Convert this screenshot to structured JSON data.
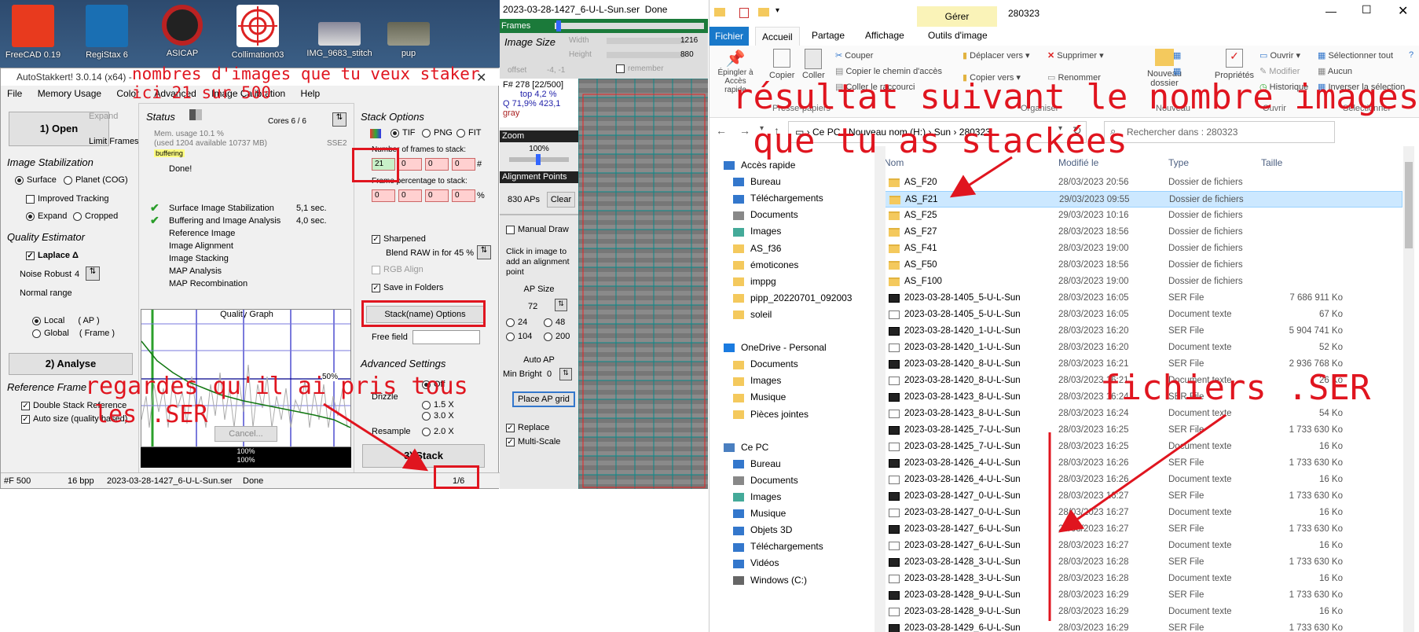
{
  "desktop": {
    "icons": [
      {
        "label": "FreeCAD 0.19"
      },
      {
        "label": "RegiStax 6"
      },
      {
        "label": "ASICAP"
      },
      {
        "label": "Collimation03"
      },
      {
        "label": "IMG_9683_stitch"
      },
      {
        "label": "pup"
      }
    ]
  },
  "autostakkert": {
    "title": "AutoStakkert! 3.0.14 (x64) - ",
    "menu": [
      "File",
      "Memory Usage",
      "Color",
      "Advanced",
      "Image Calibration",
      "Help"
    ],
    "open_button": "1) Open",
    "expand_label": "Expand",
    "limit_frames": "Limit Frames",
    "image_stabilization": "Image Stabilization",
    "surface": "Surface",
    "planet": "Planet (COG)",
    "improved_tracking": "Improved Tracking",
    "expand": "Expand",
    "cropped": "Cropped",
    "quality_estimator": "Quality Estimator",
    "laplace": "Laplace Δ",
    "noise_robust": "Noise Robust",
    "noise_value": "4",
    "normal_range": "Normal range",
    "local": "Local",
    "local_ap": "( AP )",
    "global": "Global",
    "global_frame": "( Frame )",
    "analyse_button": "2) Analyse",
    "reference_frame": "Reference Frame",
    "double_stack": "Double Stack Reference",
    "auto_size": "Auto size (quality based)",
    "status": "Status",
    "cores": "Cores 6 / 6",
    "mem_usage": "Mem. usage 10.1 %",
    "mem_used": "(used 1204 available 10737 MB)",
    "sse": "SSE2",
    "buffering": "buffering",
    "done": "Done!",
    "steps": [
      {
        "name": "Surface Image Stabilization",
        "time": "5,1 sec.",
        "done": true
      },
      {
        "name": "Buffering and Image Analysis",
        "time": "4,0 sec.",
        "done": true
      },
      {
        "name": "Reference Image",
        "time": "",
        "done": false
      },
      {
        "name": "Image Alignment",
        "time": "",
        "done": false
      },
      {
        "name": "Image Stacking",
        "time": "",
        "done": false
      },
      {
        "name": "MAP Analysis",
        "time": "",
        "done": false
      },
      {
        "name": "MAP Recombination",
        "time": "",
        "done": false
      }
    ],
    "quality_graph": "Quality Graph",
    "pct50": "50%",
    "cancel": "Cancel...",
    "pct100a": "100%",
    "pct100b": "100%",
    "stack_options": "Stack Options",
    "tif": "TIF",
    "png": "PNG",
    "fit": "FIT",
    "frames_to_stack": "Number of frames to stack:",
    "frames_values": [
      "21",
      "0",
      "0",
      "0"
    ],
    "hash": "#",
    "frame_pct": "Frame percentage to stack:",
    "pct_values": [
      "0",
      "0",
      "0",
      "0"
    ],
    "pct_sign": "%",
    "sharpened": "Sharpened",
    "blend_raw": "Blend RAW in for 45 %",
    "rgb_align": "RGB Align",
    "save_folders": "Save in Folders",
    "stack_name_options": "Stack(name) Options",
    "free_field": "Free field",
    "advanced_settings": "Advanced Settings",
    "drizzle": "Drizzle",
    "off": "Off",
    "d15": "1.5 X",
    "d30": "3.0 X",
    "resample": "Resample",
    "r20": "2.0 X",
    "stack_button": "3) Stack",
    "statusbar": {
      "frames": "#F 500",
      "bpp": "16 bpp",
      "file": "2023-03-28-1427_6-U-L-Sun.ser",
      "state": "Done",
      "progress": "1/6"
    }
  },
  "ser_viewer": {
    "title": "2023-03-28-1427_6-U-L-Sun.ser",
    "title_state": "Done",
    "frames": "Frames",
    "image_size": "Image Size",
    "width": "Width",
    "height": "Height",
    "width_val": "1216",
    "height_val": "880",
    "offset": "offset",
    "offset_val": "-4, -1",
    "remember": "remember",
    "frame_info": "F# 278 [22/500]",
    "top_pct": "top 4,2 %",
    "q_info": "Q 71,9%   423,1",
    "gray": "gray",
    "zoom": "Zoom",
    "zoom_val": "100%",
    "alignment_points": "Alignment Points",
    "aps": "830 APs",
    "clear": "Clear",
    "manual_draw": "Manual Draw",
    "click_help": "Click in image to add an alignment point",
    "ap_size": "AP Size",
    "ap_sizes": [
      "72",
      "24",
      "48",
      "104",
      "200"
    ],
    "auto_ap": "Auto AP",
    "min_bright": "Min Bright",
    "min_bright_val": "0",
    "place_grid": "Place AP grid",
    "replace": "Replace",
    "multiscale": "Multi-Scale"
  },
  "explorer": {
    "manage": "Gérer",
    "window_title": "280323",
    "tabs": [
      "Fichier",
      "Accueil",
      "Partage",
      "Affichage",
      "Outils d'image"
    ],
    "ribbon": {
      "pin": "Épingler à Accès rapide",
      "copy": "Copier",
      "paste": "Coller",
      "cut": "Couper",
      "copy_path": "Copier le chemin d'accès",
      "paste_shortcut": "Coller le raccourci",
      "clipboard": "Presse-papiers",
      "move_to": "Déplacer vers",
      "copy_to": "Copier vers",
      "delete": "Supprimer",
      "rename": "Renommer",
      "organize": "Organiser",
      "new_folder": "Nouveau dossier",
      "new_group": "Nouveau",
      "properties": "Propriétés",
      "open": "Ouvrir",
      "modify": "Modifier",
      "history": "Historique",
      "open_group": "Ouvrir",
      "select_all": "Sélectionner tout",
      "select_none": "Aucun",
      "invert": "Inverser la sélection",
      "select_group": "Sélectionner"
    },
    "breadcrumb": [
      "Ce PC",
      "Nouveau nom (H:)",
      "Sun",
      "280323"
    ],
    "search_placeholder": "Rechercher dans : 280323",
    "nav": [
      {
        "label": "Accès rapide",
        "indent": 0,
        "type": "star"
      },
      {
        "label": "Bureau",
        "indent": 1,
        "type": "blue"
      },
      {
        "label": "Téléchargements",
        "indent": 1,
        "type": "down"
      },
      {
        "label": "Documents",
        "indent": 1,
        "type": "doc"
      },
      {
        "label": "Images",
        "indent": 1,
        "type": "img"
      },
      {
        "label": "AS_f36",
        "indent": 1,
        "type": "folder"
      },
      {
        "label": "émoticones",
        "indent": 1,
        "type": "folder"
      },
      {
        "label": "imppg",
        "indent": 1,
        "type": "folder"
      },
      {
        "label": "pipp_20220701_092003",
        "indent": 1,
        "type": "folder"
      },
      {
        "label": "soleil",
        "indent": 1,
        "type": "folder"
      },
      {
        "label": "",
        "indent": 0,
        "type": "gap"
      },
      {
        "label": "OneDrive - Personal",
        "indent": 0,
        "type": "cloud"
      },
      {
        "label": "Documents",
        "indent": 1,
        "type": "folder"
      },
      {
        "label": "Images",
        "indent": 1,
        "type": "folder"
      },
      {
        "label": "Musique",
        "indent": 1,
        "type": "folder"
      },
      {
        "label": "Pièces jointes",
        "indent": 1,
        "type": "folder"
      },
      {
        "label": "",
        "indent": 0,
        "type": "gap"
      },
      {
        "label": "Ce PC",
        "indent": 0,
        "type": "pc"
      },
      {
        "label": "Bureau",
        "indent": 1,
        "type": "blue"
      },
      {
        "label": "Documents",
        "indent": 1,
        "type": "doc"
      },
      {
        "label": "Images",
        "indent": 1,
        "type": "img"
      },
      {
        "label": "Musique",
        "indent": 1,
        "type": "music"
      },
      {
        "label": "Objets 3D",
        "indent": 1,
        "type": "obj"
      },
      {
        "label": "Téléchargements",
        "indent": 1,
        "type": "down"
      },
      {
        "label": "Vidéos",
        "indent": 1,
        "type": "vid"
      },
      {
        "label": "Windows (C:)",
        "indent": 1,
        "type": "drive"
      }
    ],
    "columns": [
      "Nom",
      "Modifié le",
      "Type",
      "Taille"
    ],
    "files": [
      {
        "name": "AS_F20",
        "date": "28/03/2023 20:56",
        "type": "Dossier de fichiers",
        "size": "",
        "kind": "folder"
      },
      {
        "name": "AS_F21",
        "date": "29/03/2023 09:55",
        "type": "Dossier de fichiers",
        "size": "",
        "kind": "folder"
      },
      {
        "name": "AS_F25",
        "date": "29/03/2023 10:16",
        "type": "Dossier de fichiers",
        "size": "",
        "kind": "folder"
      },
      {
        "name": "AS_F27",
        "date": "28/03/2023 18:56",
        "type": "Dossier de fichiers",
        "size": "",
        "kind": "folder"
      },
      {
        "name": "AS_F41",
        "date": "28/03/2023 19:00",
        "type": "Dossier de fichiers",
        "size": "",
        "kind": "folder"
      },
      {
        "name": "AS_F50",
        "date": "28/03/2023 18:56",
        "type": "Dossier de fichiers",
        "size": "",
        "kind": "folder"
      },
      {
        "name": "AS_F100",
        "date": "28/03/2023 19:00",
        "type": "Dossier de fichiers",
        "size": "",
        "kind": "folder"
      },
      {
        "name": "2023-03-28-1405_5-U-L-Sun",
        "date": "28/03/2023 16:05",
        "type": "SER File",
        "size": "7 686 911 Ko",
        "kind": "ser"
      },
      {
        "name": "2023-03-28-1405_5-U-L-Sun",
        "date": "28/03/2023 16:05",
        "type": "Document texte",
        "size": "67 Ko",
        "kind": "txt"
      },
      {
        "name": "2023-03-28-1420_1-U-L-Sun",
        "date": "28/03/2023 16:20",
        "type": "SER File",
        "size": "5 904 741 Ko",
        "kind": "ser"
      },
      {
        "name": "2023-03-28-1420_1-U-L-Sun",
        "date": "28/03/2023 16:20",
        "type": "Document texte",
        "size": "52 Ko",
        "kind": "txt"
      },
      {
        "name": "2023-03-28-1420_8-U-L-Sun",
        "date": "28/03/2023 16:21",
        "type": "SER File",
        "size": "2 936 768 Ko",
        "kind": "ser"
      },
      {
        "name": "2023-03-28-1420_8-U-L-Sun",
        "date": "28/03/2023 16:21",
        "type": "Document texte",
        "size": "26 Ko",
        "kind": "txt"
      },
      {
        "name": "2023-03-28-1423_8-U-L-Sun",
        "date": "28/03/2023 16:24",
        "type": "SER File",
        "size": "",
        "kind": "ser"
      },
      {
        "name": "2023-03-28-1423_8-U-L-Sun",
        "date": "28/03/2023 16:24",
        "type": "Document texte",
        "size": "54 Ko",
        "kind": "txt"
      },
      {
        "name": "2023-03-28-1425_7-U-L-Sun",
        "date": "28/03/2023 16:25",
        "type": "SER File",
        "size": "1 733 630 Ko",
        "kind": "ser"
      },
      {
        "name": "2023-03-28-1425_7-U-L-Sun",
        "date": "28/03/2023 16:25",
        "type": "Document texte",
        "size": "16 Ko",
        "kind": "txt"
      },
      {
        "name": "2023-03-28-1426_4-U-L-Sun",
        "date": "28/03/2023 16:26",
        "type": "SER File",
        "size": "1 733 630 Ko",
        "kind": "ser"
      },
      {
        "name": "2023-03-28-1426_4-U-L-Sun",
        "date": "28/03/2023 16:26",
        "type": "Document texte",
        "size": "16 Ko",
        "kind": "txt"
      },
      {
        "name": "2023-03-28-1427_0-U-L-Sun",
        "date": "28/03/2023 16:27",
        "type": "SER File",
        "size": "1 733 630 Ko",
        "kind": "ser"
      },
      {
        "name": "2023-03-28-1427_0-U-L-Sun",
        "date": "28/03/2023 16:27",
        "type": "Document texte",
        "size": "16 Ko",
        "kind": "txt"
      },
      {
        "name": "2023-03-28-1427_6-U-L-Sun",
        "date": "28/03/2023 16:27",
        "type": "SER File",
        "size": "1 733 630 Ko",
        "kind": "ser"
      },
      {
        "name": "2023-03-28-1427_6-U-L-Sun",
        "date": "28/03/2023 16:27",
        "type": "Document texte",
        "size": "16 Ko",
        "kind": "txt"
      },
      {
        "name": "2023-03-28-1428_3-U-L-Sun",
        "date": "28/03/2023 16:28",
        "type": "SER File",
        "size": "1 733 630 Ko",
        "kind": "ser"
      },
      {
        "name": "2023-03-28-1428_3-U-L-Sun",
        "date": "28/03/2023 16:28",
        "type": "Document texte",
        "size": "16 Ko",
        "kind": "txt"
      },
      {
        "name": "2023-03-28-1428_9-U-L-Sun",
        "date": "28/03/2023 16:29",
        "type": "SER File",
        "size": "1 733 630 Ko",
        "kind": "ser"
      },
      {
        "name": "2023-03-28-1428_9-U-L-Sun",
        "date": "28/03/2023 16:29",
        "type": "Document texte",
        "size": "16 Ko",
        "kind": "txt"
      },
      {
        "name": "2023-03-28-1429_6-U-L-Sun",
        "date": "28/03/2023 16:29",
        "type": "SER File",
        "size": "1 733 630 Ko",
        "kind": "ser"
      }
    ]
  },
  "annotations": {
    "nb_images": "nombres d'images que tu veux staker",
    "nb_images_2": "ici 21 sur 500",
    "pris_tous": "regardes qu'il ai pris tous",
    "pris_tous_2": "les .SER",
    "resultat": "résultat suivant le nombre images",
    "resultat_2": "que tu as stackées",
    "fichiers_ser": "fichiers .SER"
  }
}
